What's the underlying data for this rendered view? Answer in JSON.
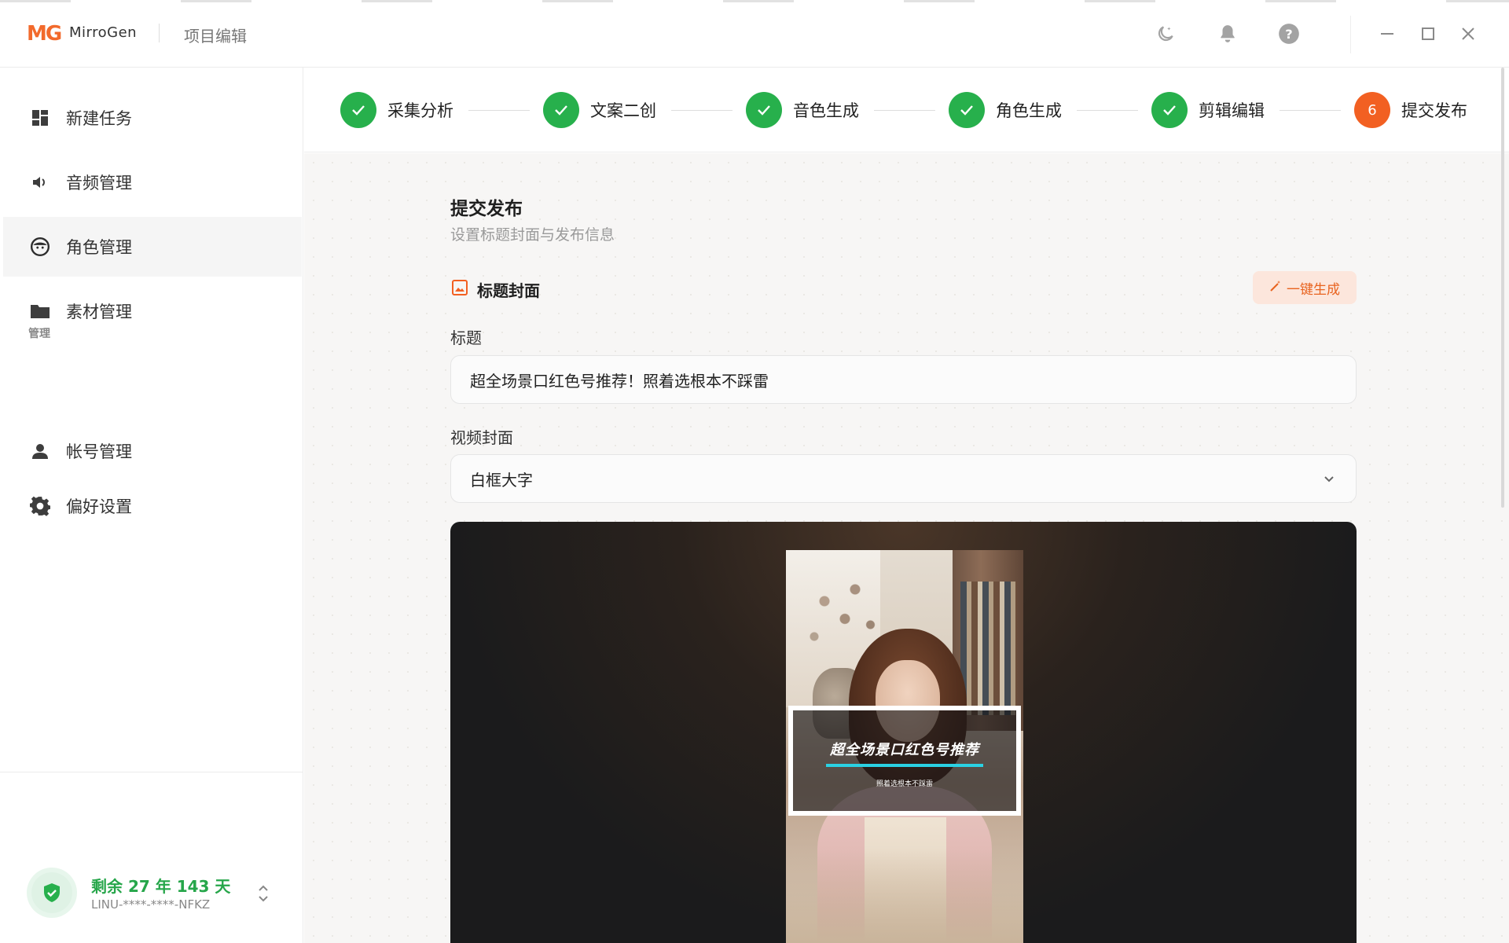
{
  "app": {
    "logo_text": "MG",
    "name": "MirroGen",
    "window_title": "项目编辑"
  },
  "top_icons": [
    "moon-icon",
    "bell-icon",
    "help-icon",
    "minimize-icon",
    "maximize-icon",
    "close-icon"
  ],
  "sidebar": {
    "items": [
      {
        "label": "新建任务",
        "icon": "dashboard-icon"
      },
      {
        "label": "音频管理",
        "icon": "speaker-icon"
      },
      {
        "label": "角色管理",
        "icon": "face-icon",
        "active": true
      },
      {
        "label": "素材管理",
        "icon": "folder-icon"
      }
    ],
    "section_label": "管理",
    "manage_items": [
      {
        "label": "帐号管理",
        "icon": "user-icon"
      },
      {
        "label": "偏好设置",
        "icon": "gear-icon"
      }
    ],
    "license": {
      "remaining": "剩余 27 年 143 天",
      "code": "LINU-****-****-NFKZ"
    }
  },
  "steps": [
    {
      "label": "采集分析",
      "status": "done"
    },
    {
      "label": "文案二创",
      "status": "done"
    },
    {
      "label": "音色生成",
      "status": "done"
    },
    {
      "label": "角色生成",
      "status": "done"
    },
    {
      "label": "剪辑编辑",
      "status": "done"
    },
    {
      "label": "提交发布",
      "status": "current",
      "number": "6"
    }
  ],
  "main": {
    "title": "提交发布",
    "subtitle": "设置标题封面与发布信息",
    "section_title": "标题封面",
    "generate_button": "一键生成",
    "title_label": "标题",
    "title_value": "超全场景口红色号推荐！照着选根本不踩雷",
    "cover_label": "视频封面",
    "cover_value": "白框大字",
    "preview": {
      "headline": "超全场景口红色号推荐",
      "subline": "照着选根本不踩雷"
    }
  },
  "colors": {
    "accent": "#f26022",
    "success": "#27b04c",
    "highlight_line": "#2ad1e3"
  }
}
